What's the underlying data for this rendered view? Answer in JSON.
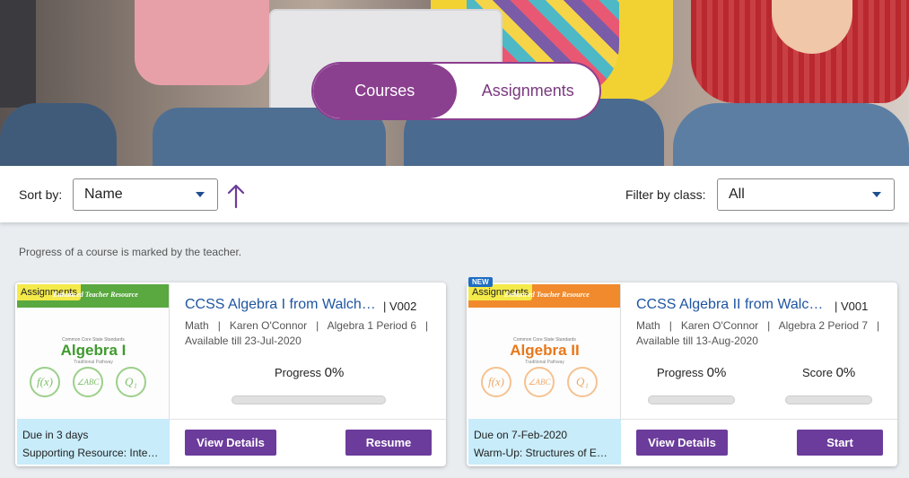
{
  "nav": {
    "courses_label": "Courses",
    "assignments_label": "Assignments",
    "active": "Courses"
  },
  "sort": {
    "label": "Sort by:",
    "value": "Name",
    "direction_icon": "arrow-up-icon"
  },
  "filter": {
    "label": "Filter by class:",
    "value": "All"
  },
  "note": "Progress of a course is marked by the teacher.",
  "colors": {
    "brand_purple": "#8b3f8f",
    "button_purple": "#6b3c9b",
    "link_blue": "#1f55a0",
    "due_bg": "#c8ecfa",
    "tag_yellow": "#f4ea4a",
    "new_blue": "#1e6dc2"
  },
  "cards": [
    {
      "tag": "Assignments",
      "is_new": false,
      "thumbnail": {
        "header": "Enhanced Teacher Resource",
        "subheader": "Common Core State Standards",
        "title": "Algebra I",
        "pathway": "Traditional Pathway",
        "icons": [
          "f(x)",
          "∠ABC",
          "Q₁"
        ],
        "color": "#5aa840",
        "title_color": "#3f9a2e"
      },
      "title": "CCSS Algebra I from Walch…",
      "version": "| V002",
      "subject": "Math",
      "teacher": "Karen O'Connor",
      "class_name": "Algebra 1 Period 6",
      "available": "Available till 23-Jul-2020",
      "progress_label": "Progress",
      "progress_value": "0%",
      "progress_fraction": 0,
      "due": "Due in 3 days",
      "resource": "Supporting Resource: Inte…",
      "view_label": "View Details",
      "action_label": "Resume"
    },
    {
      "tag": "Assignments",
      "is_new": true,
      "new_label": "NEW",
      "thumbnail": {
        "header": "Enhanced Teacher Resource",
        "subheader": "Common Core State Standards",
        "title": "Algebra II",
        "pathway": "Traditional Pathway",
        "icons": [
          "f(x)",
          "∠ABC",
          "Q₁"
        ],
        "color": "#f08a2c",
        "title_color": "#e8781a"
      },
      "title": "CCSS Algebra II from Walc…",
      "version": "| V001",
      "subject": "Math",
      "teacher": "Karen O'Connor",
      "class_name": "Algebra 2 Period 7",
      "available": "Available till 13-Aug-2020",
      "progress_label": "Progress",
      "progress_value": "0%",
      "progress_fraction": 0,
      "score_label": "Score",
      "score_value": "0%",
      "score_fraction": 0,
      "due": "Due on 7-Feb-2020",
      "resource": "Warm-Up: Structures of E…",
      "view_label": "View Details",
      "action_label": "Start"
    }
  ]
}
